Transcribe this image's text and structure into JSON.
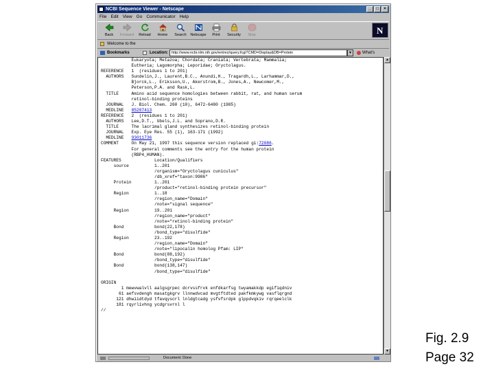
{
  "window": {
    "title": "NCBI Sequence Viewer - Netscape",
    "controls": [
      "_",
      "□",
      "×"
    ]
  },
  "menu": [
    "File",
    "Edit",
    "View",
    "Go",
    "Communicator",
    "Help"
  ],
  "toolbar": [
    {
      "label": "Back",
      "icon": "back-arrow-icon",
      "enabled": true
    },
    {
      "label": "Forward",
      "icon": "forward-arrow-icon",
      "enabled": false
    },
    {
      "label": "Reload",
      "icon": "reload-icon",
      "enabled": true
    },
    {
      "label": "Home",
      "icon": "home-icon",
      "enabled": true
    },
    {
      "label": "Search",
      "icon": "search-icon",
      "enabled": true
    },
    {
      "label": "Netscape",
      "icon": "netscape-icon",
      "enabled": true
    },
    {
      "label": "Print",
      "icon": "print-icon",
      "enabled": true
    },
    {
      "label": "Security",
      "icon": "security-icon",
      "enabled": true
    },
    {
      "label": "Stop",
      "icon": "stop-icon",
      "enabled": false
    }
  ],
  "bookmarks_row": {
    "label": "Welcome to the"
  },
  "location_bar": {
    "bookmarks_label": "Bookmarks",
    "location_label": "Location:",
    "url": "http://www.ncbi.nlm.nih.gov/entrez/query.fcgi?CMD=Display&DB=Protein",
    "related_label": "What's Related"
  },
  "record": {
    "lines": [
      {
        "t": "            Eukaryota; Metazoa; Chordata; Craniata; Vertebrata; Mammalia;"
      },
      {
        "t": "            Eutheria; Lagomorpha; Leporidae; Oryctolagus."
      },
      {
        "t": "REFERENCE   1  (residues 1 to 201)"
      },
      {
        "t": "  AUTHORS   Sundelin,J., Laurent,B.C., Anundi,H., Tragardh,L., Larhammar,D.,"
      },
      {
        "t": "            Bjorck,L., Eriksson,U., Akerstrom,B., Jones,A., Newcomer,M.,"
      },
      {
        "t": "            Peterson,P.A. and Rask,L."
      },
      {
        "t": "  TITLE     Amino acid sequence homologies between rabbit, rat, and human serum"
      },
      {
        "t": "            retinol-binding proteins"
      },
      {
        "t": "  JOURNAL   J. Biol. Chem. 260 (10), 6472-6480 (1985)"
      },
      {
        "t": "  MEDLINE   ",
        "link": "85207413"
      },
      {
        "t": "REFERENCE   2  (residues 1 to 201)"
      },
      {
        "t": "  AUTHORS   Lee,D.T., Ubels,J.L. and Soprano,D.R."
      },
      {
        "t": "  TITLE     The lacrimal gland synthesizes retinol-binding protein"
      },
      {
        "t": "  JOURNAL   Exp. Eye Res. 55 (1), 163-171 (1992)"
      },
      {
        "t": "  MEDLINE   ",
        "link": "93011736"
      },
      {
        "t": "COMMENT     On May 21, 1997 this sequence version replaced gi:",
        "link": "72086",
        "after": "."
      },
      {
        "t": "            For general comments see the entry for the human protein"
      },
      {
        "t": "            (RBP4_HUMAN)."
      },
      {
        "t": "FEATURES             Location/Qualifiers"
      },
      {
        "t": "     source          1..201"
      },
      {
        "t": "                     /organism=\"Oryctolagus cuniculus\""
      },
      {
        "t": "                     /db_xref=\"taxon:9986\""
      },
      {
        "t": "     Protein         1..201"
      },
      {
        "t": "                     /product=\"retinol-binding protein precursor\""
      },
      {
        "t": "     Region          1..18"
      },
      {
        "t": "                     /region_name=\"Domain\""
      },
      {
        "t": "                     /note=\"signal sequence\""
      },
      {
        "t": "     Region          19..201"
      },
      {
        "t": "                     /region_name=\"product\""
      },
      {
        "t": "                     /note=\"retinol-binding protein\""
      },
      {
        "t": "     Bond            bond(22,178)"
      },
      {
        "t": "                     /bond_type=\"disulfide\""
      },
      {
        "t": "     Region          23..192"
      },
      {
        "t": "                     /region_name=\"Domain\""
      },
      {
        "t": "                     /note=\"lipocalin homolog Pfam: LIP\""
      },
      {
        "t": "     Bond            bond(88,192)"
      },
      {
        "t": "                     /bond_type=\"disulfide\""
      },
      {
        "t": "     Bond            bond(138,147)"
      },
      {
        "t": "                     /bond_type=\"disulfide\""
      },
      {
        "t": ""
      },
      {
        "t": "ORIGIN"
      },
      {
        "t": "        1 mewvwalvll aalgsgrpec dcrvssfrvk enfdkarfsg twyamakkdp egifiqdniv"
      },
      {
        "t": "       61 aefsvdengh masatgkgrv llnnwdvcad mvgtftdted pakfkmkywg vasflqrgnd"
      },
      {
        "t": "      121 dhwiidtdyd tfavqyscrl lnldgtcadg ysfvfsrdpk glppdvqkiv rqrqeelclk"
      },
      {
        "t": "      181 rqyrlivhng ycdgrsvrnl l"
      },
      {
        "t": "//"
      }
    ]
  },
  "status": {
    "text": "Document: Done"
  },
  "caption": {
    "line1": "Fig. 2.9",
    "line2": "Page 32"
  }
}
